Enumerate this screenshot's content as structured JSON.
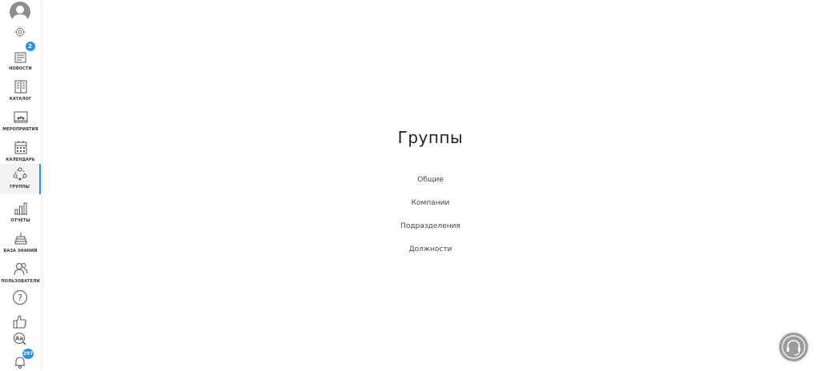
{
  "page": {
    "title": "Группы"
  },
  "groups": [
    {
      "label": "Общие"
    },
    {
      "label": "Компании"
    },
    {
      "label": "Подразделения"
    },
    {
      "label": "Должности"
    }
  ],
  "sidebar": {
    "news_badge": "2",
    "notifications_badge": "297",
    "accent_color": "#2d8fe6",
    "items": [
      {
        "label": "НОВОСТИ",
        "icon": "news-icon"
      },
      {
        "label": "КАТАЛОГ",
        "icon": "catalog-icon"
      },
      {
        "label": "МЕРОПРИЯТИЯ",
        "icon": "events-icon"
      },
      {
        "label": "КАЛЕНДАРЬ",
        "icon": "calendar-icon"
      },
      {
        "label": "ГРУППЫ",
        "icon": "groups-icon",
        "active": true
      },
      {
        "label": "ОТЧЕТЫ",
        "icon": "reports-icon"
      },
      {
        "label": "БАЗА ЗНАНИЙ",
        "icon": "knowledge-base-icon"
      },
      {
        "label": "ПОЛЬЗОВАТЕЛИ",
        "icon": "users-icon"
      }
    ],
    "extra_icons": [
      "help-icon",
      "thumbs-up-icon",
      "font-size-icon",
      "bell-icon"
    ]
  },
  "support": {
    "icon": "headset-icon"
  }
}
